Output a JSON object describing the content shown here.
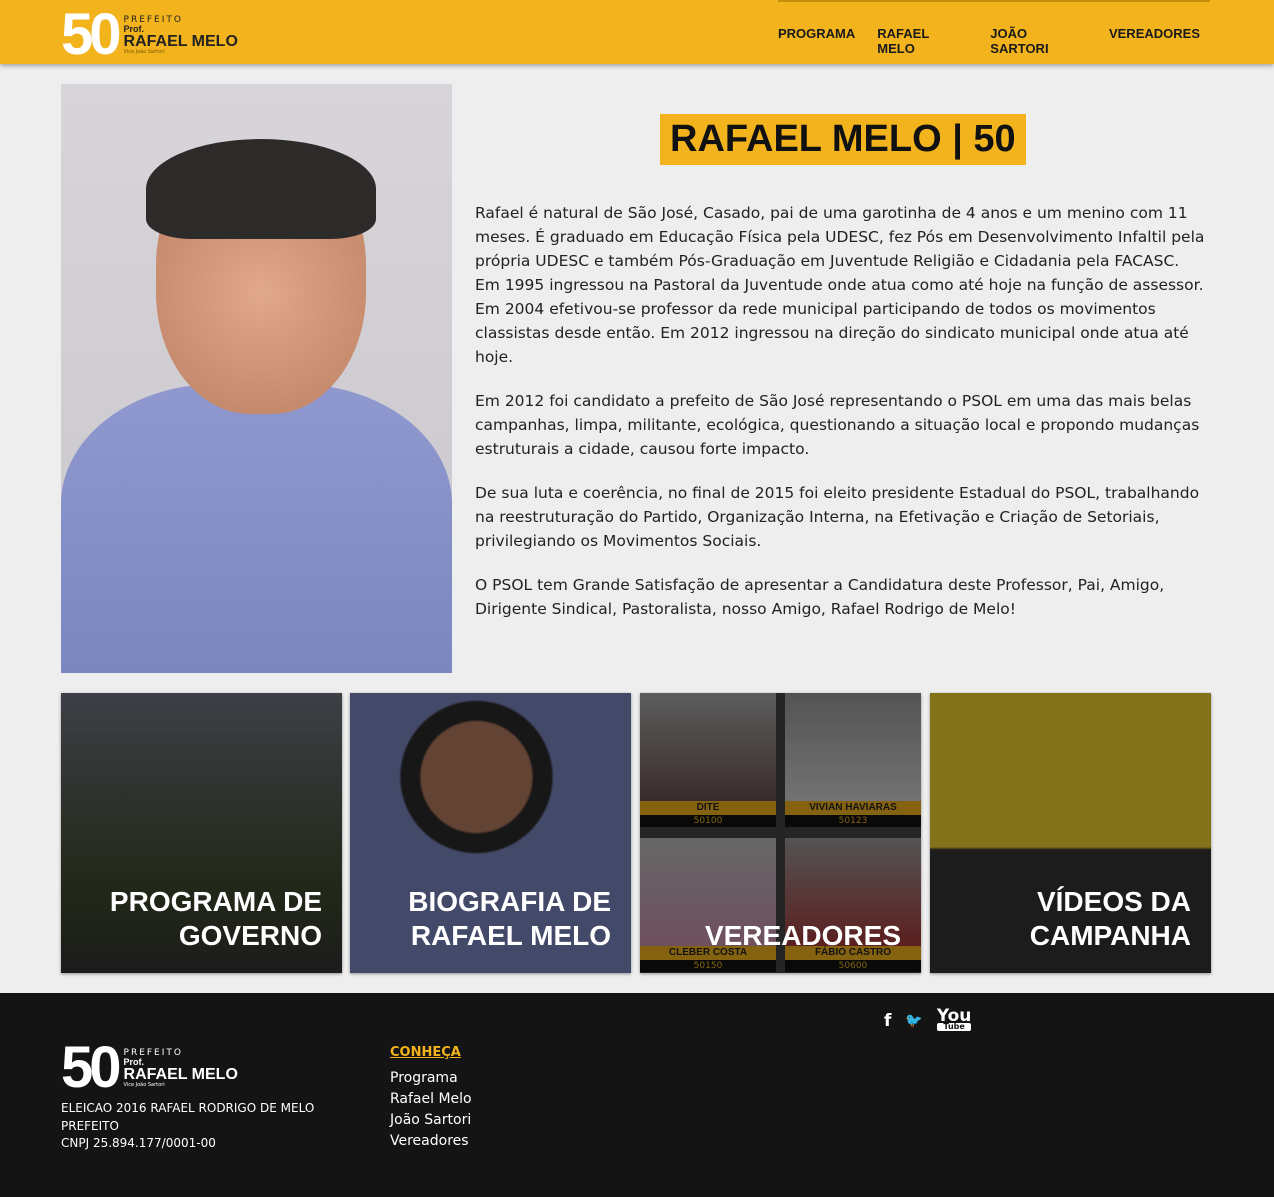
{
  "header": {
    "logo": {
      "number": "50",
      "line1": "PREFEITO",
      "line2": "Prof.",
      "line3": "RAFAEL MELO",
      "line4": "Vice João Sartori"
    },
    "nav": [
      "PROGRAMA",
      "RAFAEL MELO",
      "JOÃO SARTORI",
      "VEREADORES"
    ]
  },
  "main": {
    "title": "RAFAEL MELO | 50",
    "paragraphs": [
      "Rafael é natural de São José, Casado, pai de uma garotinha de 4 anos e um menino com 11 meses. É graduado em Educação Física pela UDESC, fez Pós em Desenvolvimento Infaltil pela própria UDESC e também Pós-Graduação em Juventude Religião e Cidadania pela FACASC. Em 1995 ingressou na Pastoral da Juventude onde atua como até hoje na função de assessor. Em 2004 efetivou-se professor da rede municipal participando de todos os movimentos classistas desde então. Em 2012 ingressou na direção do sindicato municipal onde atua até hoje.",
      "Em 2012 foi candidato a prefeito de São José representando o PSOL em uma das mais belas campanhas, limpa, militante, ecológica, questionando a situação local e propondo mudanças estruturais a cidade, causou forte impacto.",
      "De sua luta e coerência, no final de 2015 foi eleito presidente Estadual do PSOL, trabalhando na reestruturação do Partido, Organização Interna, na Efetivação e Criação de Setoriais, privilegiando os Movimentos Sociais.",
      "O PSOL tem Grande Satisfação de apresentar a Candidatura deste Professor, Pai, Amigo, Dirigente Sindical, Pastoralista, nosso Amigo, Rafael Rodrigo de Melo!"
    ]
  },
  "tiles": [
    {
      "l1": "PROGRAMA DE",
      "l2": "GOVERNO"
    },
    {
      "l1": "BIOGRAFIA DE",
      "l2": "RAFAEL MELO"
    },
    {
      "l1": "",
      "l2": "VEREADORES",
      "candidates": [
        {
          "name": "DITE",
          "number": "50100"
        },
        {
          "name": "VIVIAN HAVIARAS",
          "number": "50123"
        },
        {
          "name": "CLEBER COSTA",
          "number": "50150"
        },
        {
          "name": "FÁBIO CASTRO",
          "number": "50600"
        }
      ]
    },
    {
      "l1": "VÍDEOS DA",
      "l2": "CAMPANHA"
    }
  ],
  "footer": {
    "info": [
      "ELEICAO 2016 RAFAEL RODRIGO DE MELO PREFEITO",
      "CNPJ 25.894.177/0001-00"
    ],
    "conheca_title": "CONHEÇA",
    "links": [
      "Programa",
      "Rafael Melo",
      "João Sartori",
      "Vereadores"
    ],
    "social": {
      "facebook": "f",
      "twitter": "🐦",
      "youtube_top": "You",
      "youtube_bottom": "Tube"
    }
  },
  "colors": {
    "accent": "#f2b31d",
    "footer": "#141414",
    "background": "#eeeeee"
  }
}
